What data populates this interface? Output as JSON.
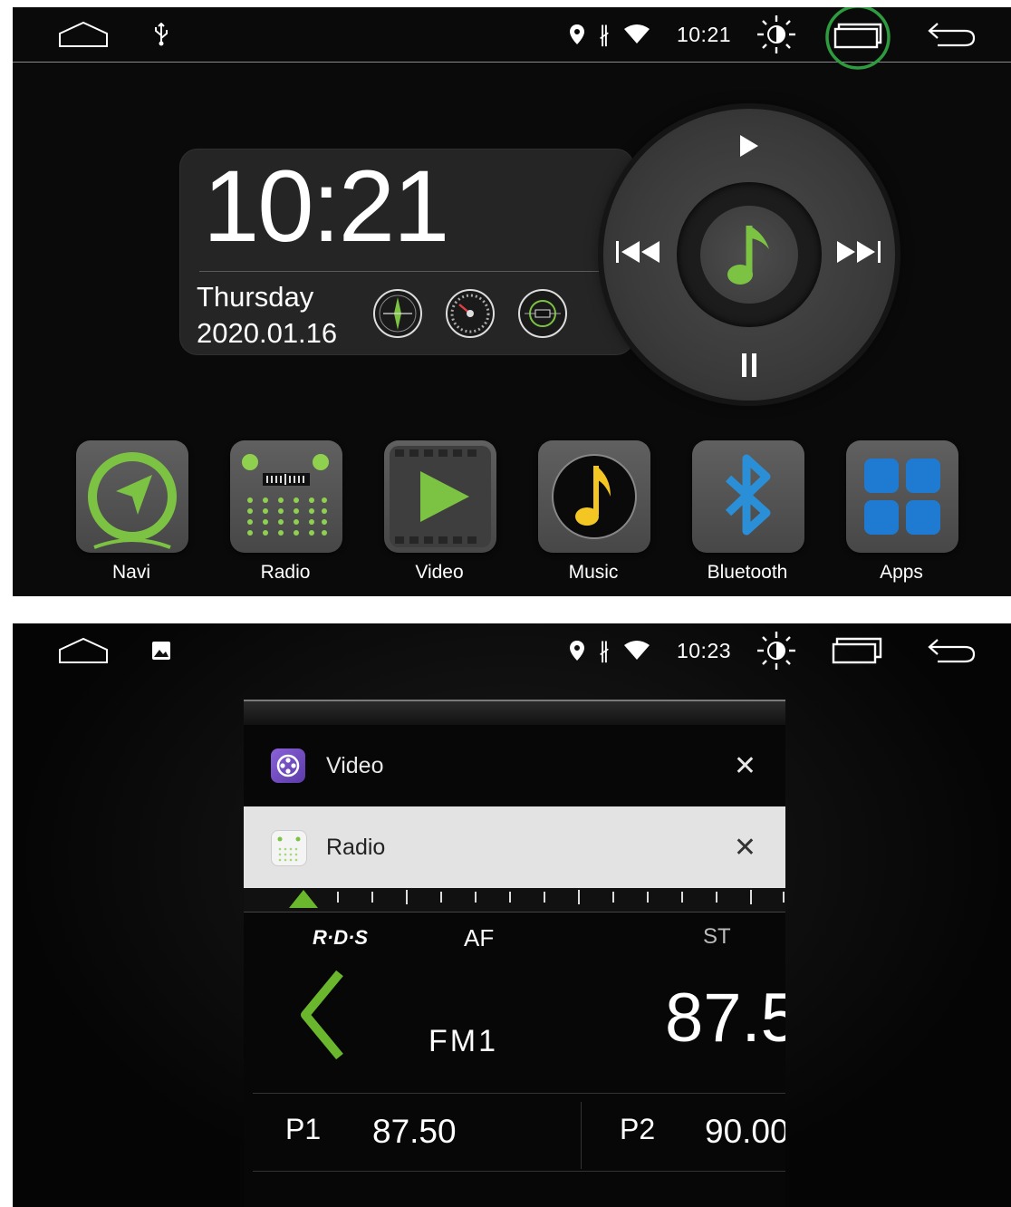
{
  "top_screen": {
    "statusbar": {
      "time": "10:21",
      "icons": [
        "home-icon",
        "usb-icon",
        "location-icon",
        "bluetooth-icon",
        "wifi-icon",
        "brightness-icon",
        "recent-apps-icon",
        "back-icon"
      ],
      "highlight_color": "#2e9b3e"
    },
    "clock_widget": {
      "time": "10:21",
      "day": "Thursday",
      "date": "2020.01.16",
      "gauges": [
        "compass-gauge-icon",
        "speedometer-gauge-icon",
        "radio-gauge-icon"
      ]
    },
    "media_controls": {
      "accent": "#7dc343",
      "buttons": [
        "play-icon",
        "previous-icon",
        "next-icon",
        "pause-icon",
        "music-note-icon"
      ]
    },
    "apps": [
      {
        "label": "Navi",
        "icon": "navigation-icon"
      },
      {
        "label": "Radio",
        "icon": "radio-icon"
      },
      {
        "label": "Video",
        "icon": "video-icon"
      },
      {
        "label": "Music",
        "icon": "music-icon"
      },
      {
        "label": "Bluetooth",
        "icon": "bluetooth-icon"
      },
      {
        "label": "Apps",
        "icon": "apps-grid-icon"
      }
    ]
  },
  "bottom_screen": {
    "statusbar": {
      "time": "10:23",
      "icons": [
        "home-icon",
        "gallery-icon",
        "location-icon",
        "bluetooth-icon",
        "wifi-icon",
        "brightness-icon",
        "recent-apps-icon",
        "back-icon"
      ]
    },
    "recents": {
      "cards": [
        {
          "title": "Video",
          "close": "✕",
          "icon": "video-app-icon"
        },
        {
          "title": "Radio",
          "close": "✕",
          "icon": "radio-app-icon"
        }
      ],
      "radio_preview": {
        "rds_label": "R·D·S",
        "af": "AF",
        "st": "ST",
        "band": "FM1",
        "frequency": "87.5",
        "presets": [
          {
            "label": "P1",
            "freq": "87.50"
          },
          {
            "label": "P2",
            "freq": "90.00"
          }
        ],
        "accent": "#6ab72d"
      }
    }
  }
}
